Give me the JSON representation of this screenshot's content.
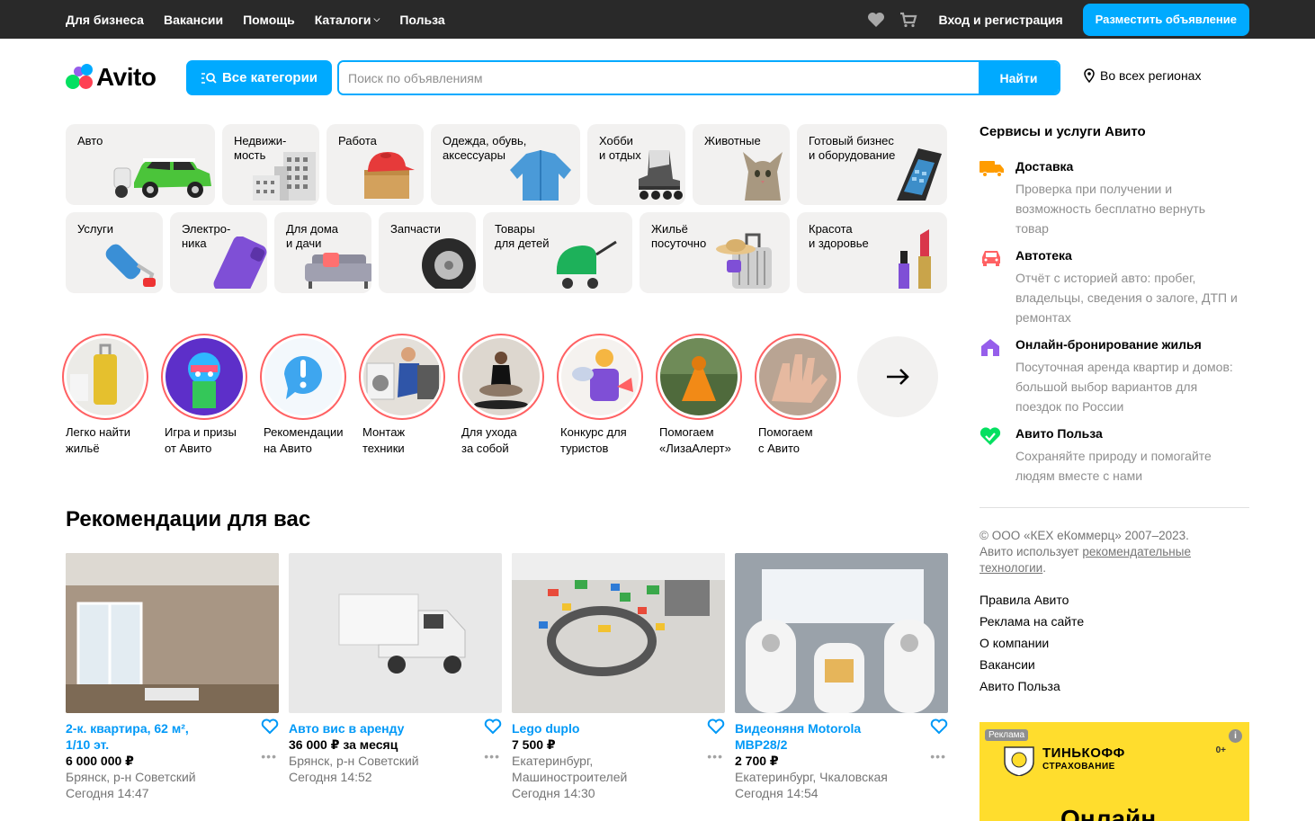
{
  "topbar": {
    "nav": [
      "Для бизнеса",
      "Вакансии",
      "Помощь",
      "Каталоги",
      "Польза"
    ],
    "login": "Вход и регистрация",
    "post_button": "Разместить объявление"
  },
  "header": {
    "logo": "Avito",
    "categories_button": "Все категории",
    "search_placeholder": "Поиск по объявлениям",
    "search_button": "Найти",
    "region": "Во всех регионах"
  },
  "categories": [
    {
      "label": "Авто",
      "icon": "car-icon"
    },
    {
      "label": "Недвижи-\nмость",
      "icon": "building-icon"
    },
    {
      "label": "Работа",
      "icon": "cap-box-icon"
    },
    {
      "label": "Одежда, обувь,\nаксессуары",
      "icon": "jacket-icon"
    },
    {
      "label": "Хобби\nи отдых",
      "icon": "roller-skate-icon"
    },
    {
      "label": "Животные",
      "icon": "cat-icon"
    },
    {
      "label": "Готовый бизнес\nи оборудование",
      "icon": "terminal-icon"
    },
    {
      "label": "Услуги",
      "icon": "paint-roller-icon"
    },
    {
      "label": "Электро-\nника",
      "icon": "phone-icon"
    },
    {
      "label": "Для дома\nи дачи",
      "icon": "sofa-icon"
    },
    {
      "label": "Запчасти",
      "icon": "tire-icon"
    },
    {
      "label": "Товары\nдля детей",
      "icon": "stroller-icon"
    },
    {
      "label": "Жильё\nпосуточно",
      "icon": "suitcase-icon"
    },
    {
      "label": "Красота\nи здоровье",
      "icon": "cosmetics-icon"
    }
  ],
  "stories": [
    "Легко найти\nжильё",
    "Игра и призы\nот Авито",
    "Рекомендации\nна Авито",
    "Монтаж\nтехники",
    "Для ухода\nза собой",
    "Конкурс для\nтуристов",
    "Помогаем\n«ЛизаАлерт»",
    "Помогаем\nс Авито"
  ],
  "recommendations": {
    "title": "Рекомендации для вас",
    "items": [
      {
        "title": "2-к. квартира, 62 м²,\n1/10 эт.",
        "price": "6 000 000 ₽",
        "location": "Брянск, р-н Советский",
        "time": "Сегодня 14:47"
      },
      {
        "title": "Авто вис в аренду",
        "price": "36 000 ₽ за месяц",
        "location": "Брянск, р-н Советский",
        "time": "Сегодня 14:52"
      },
      {
        "title": "Lego duplo",
        "price": "7 500 ₽",
        "location": "Екатеринбург,\nМашиностроителей",
        "time": "Сегодня 14:30"
      },
      {
        "title": "Видеоняня Motorola\nMBP28/2",
        "price": "2 700 ₽",
        "location": "Екатеринбург, Чкаловская",
        "time": "Сегодня 14:54"
      }
    ]
  },
  "sidebar": {
    "title": "Сервисы и услуги Авито",
    "services": [
      {
        "name": "Доставка",
        "desc": "Проверка при получении и возможность бесплатно вернуть товар",
        "icon": "truck-icon",
        "color": "#ff9c00"
      },
      {
        "name": "Автотека",
        "desc": "Отчёт с историей авто: пробег, владельцы, сведения о залоге, ДТП и ремонтах",
        "icon": "car-front-icon",
        "color": "#ff6163"
      },
      {
        "name": "Онлайн-бронирование жилья",
        "desc": "Посуточная аренда квартир и домов: большой выбор вариантов для поездок по России",
        "icon": "house-icon",
        "color": "#965eeb"
      },
      {
        "name": "Авито Польза",
        "desc": "Сохраняйте природу и помогайте людям вместе с нами",
        "icon": "heart-leaf-icon",
        "color": "#04e061"
      }
    ],
    "copyright": "© ООО «КЕХ еКоммерц» 2007–2023.",
    "copyright_text": "Авито использует",
    "copyright_link": "рекомендательные технологии",
    "footer_links": [
      "Правила Авито",
      "Реклама на сайте",
      "О компании",
      "Вакансии",
      "Авито Польза"
    ]
  },
  "ad": {
    "tag": "Реклама",
    "brand": "ТИНЬКОФФ",
    "brand_sub": "СТРАХОВАНИЕ",
    "age": "0+",
    "headline": "Онлайн"
  }
}
